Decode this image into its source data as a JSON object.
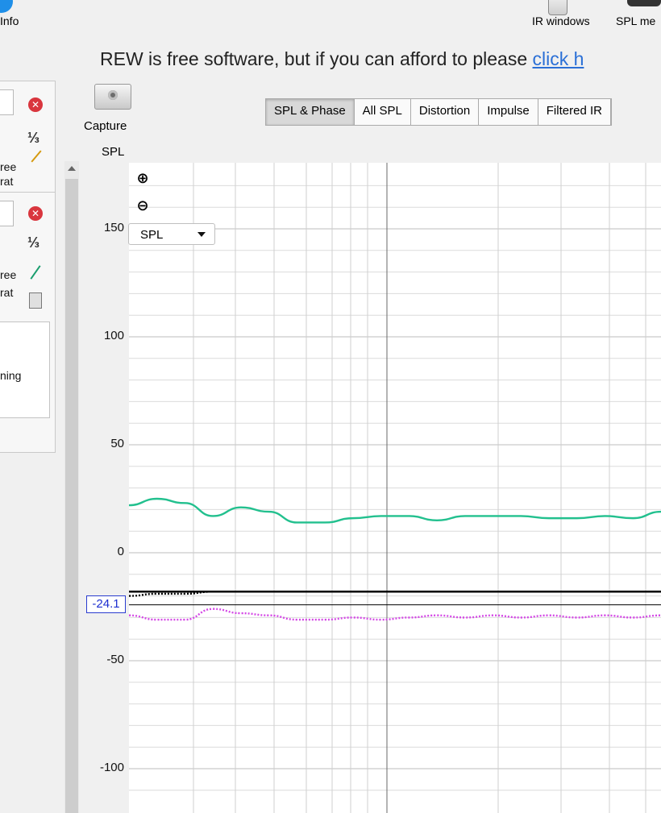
{
  "top_toolbar": {
    "info_label": "Info",
    "ir_windows_label": "IR windows",
    "spl_meter_label": "SPL me"
  },
  "donation": {
    "text": "REW is free software, but if you can afford to please ",
    "link": "click h"
  },
  "panel": {
    "freq_partial_1": "ree",
    "format_partial_1": "rat",
    "freq_partial_2": "ree",
    "format_partial_2": "rat",
    "notes_partial": "ning"
  },
  "capture": {
    "label": "Capture"
  },
  "graph_title": "SPL",
  "tabs": [
    "SPL & Phase",
    "All SPL",
    "Distortion",
    "Impulse",
    "Filtered IR"
  ],
  "graph": {
    "select_value": "SPL",
    "y_ticks": [
      "150",
      "100",
      "50",
      "0",
      "-50",
      "-100"
    ],
    "cursor_value": "-24.1"
  },
  "colors": {
    "spl_trace": "#22c08e",
    "phase_trace": "#d447e6",
    "reference_line": "#000000",
    "cursor_box": "#1d2fd0"
  },
  "chart_data": {
    "type": "line",
    "ylim": [
      -100,
      150
    ],
    "yticks": [
      150,
      100,
      50,
      0,
      -50,
      -100
    ],
    "series": [
      {
        "style": "solid",
        "color": "#22c08e",
        "values": [
          22,
          25,
          23,
          17,
          21,
          19,
          14,
          14,
          16,
          17,
          17,
          15,
          17,
          17,
          17,
          16,
          16,
          17,
          16,
          19
        ]
      },
      {
        "style": "dotted",
        "color": "#d447e6",
        "values": [
          -29,
          -31,
          -31,
          -26,
          -28,
          -29,
          -31,
          -31,
          -30,
          -31,
          -30,
          -29,
          -30,
          -29,
          -30,
          -29,
          -30,
          -29,
          -30,
          -29
        ]
      },
      {
        "style": "solid",
        "color": "#000000",
        "values": [
          -18,
          -18,
          -18,
          -18,
          -18,
          -18,
          -18,
          -18,
          -18,
          -18,
          -18,
          -18,
          -18,
          -18,
          -18,
          -18,
          -18,
          -18,
          -18,
          -18
        ]
      },
      {
        "style": "dotted",
        "color": "#000000",
        "values": [
          -20,
          -19,
          -19,
          -18,
          -18,
          -18,
          -18,
          -18,
          -18,
          -18,
          -18,
          -18,
          -18,
          -18,
          -18,
          -18,
          -18,
          -18,
          -18,
          -18
        ]
      }
    ],
    "cursor_y": -24.1
  }
}
